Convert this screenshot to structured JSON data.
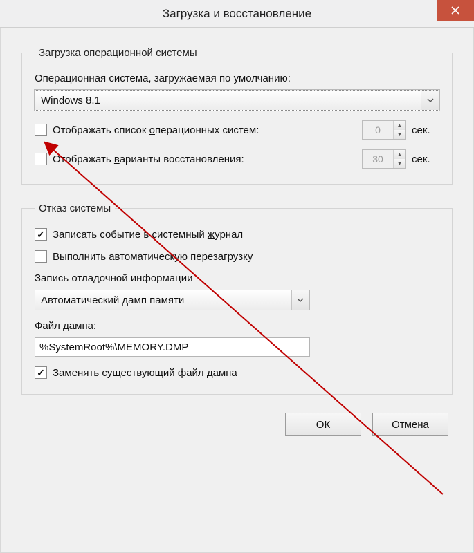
{
  "window": {
    "title": "Загрузка и восстановление"
  },
  "startup": {
    "legend": "Загрузка операционной системы",
    "default_os_label": "Операционная система, загружаемая по умолчанию:",
    "default_os_value": "Windows 8.1",
    "show_os_list_label_pre": "Отображать список ",
    "show_os_list_label_u": "о",
    "show_os_list_label_post": "перационных систем:",
    "show_os_list_value": "0",
    "show_recovery_label_pre": "Отображать ",
    "show_recovery_label_u": "в",
    "show_recovery_label_post": "арианты восстановления:",
    "show_recovery_value": "30",
    "sec_suffix": "сек."
  },
  "failure": {
    "legend": "Отказ системы",
    "log_event_label_pre": "Записать событие в системный ",
    "log_event_label_u": "ж",
    "log_event_label_post": "урнал",
    "auto_restart_label_pre": "Выполнить ",
    "auto_restart_label_u": "а",
    "auto_restart_label_post": "втоматическую перезагрузку",
    "debug_label": "Запись отладочной информации",
    "debug_value": "Автоматический дамп памяти",
    "dump_file_label": "Файл дампа:",
    "dump_file_value": "%SystemRoot%\\MEMORY.DMP",
    "overwrite_label": "Заменять существующий файл дампа"
  },
  "buttons": {
    "ok": "ОК",
    "cancel": "Отмена"
  }
}
